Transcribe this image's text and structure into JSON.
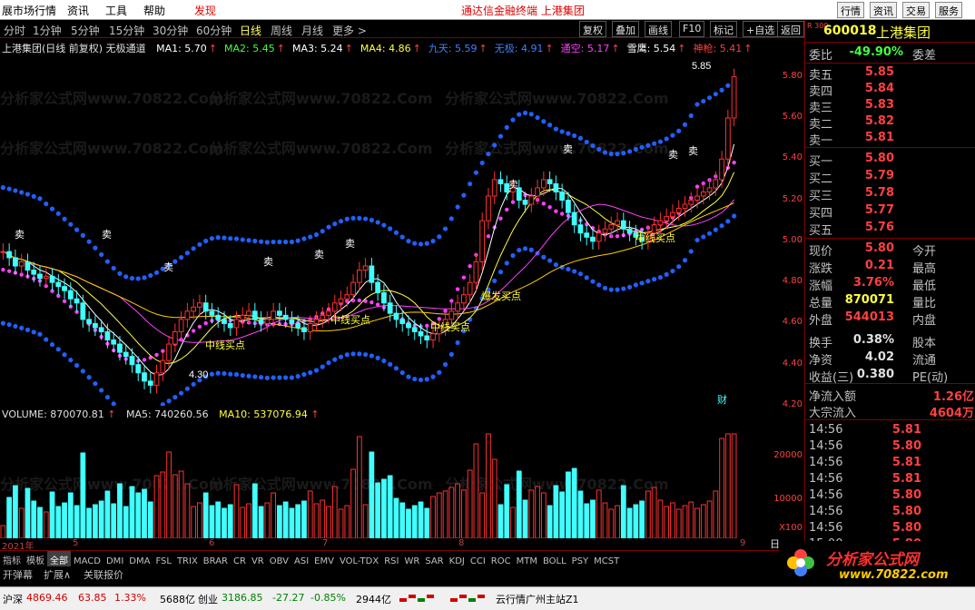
{
  "menubar": {
    "items": [
      "展市场行情",
      "资讯",
      "工具",
      "帮助",
      "发现"
    ],
    "center_title": "通达信金融终端  上港集团",
    "right_buttons": [
      "行情",
      "资讯",
      "交易",
      "服务"
    ]
  },
  "periods": {
    "items": [
      "分时",
      "1分钟",
      "5分钟",
      "15分钟",
      "30分钟",
      "60分钟",
      "日线",
      "周线",
      "月线",
      "更多 >"
    ],
    "active": "日线",
    "tools": [
      "复权",
      "叠加",
      "画线",
      "F10",
      "标记",
      "+自选",
      "返回"
    ]
  },
  "legend": {
    "title": "上港集团(日线 前复权) 无极通道",
    "items": [
      {
        "label": "MA1: 5.70",
        "color": "#ffffff"
      },
      {
        "label": "MA2: 5.45",
        "color": "#40ff40"
      },
      {
        "label": "MA3: 5.24",
        "color": "#ffffff"
      },
      {
        "label": "MA4: 4.86",
        "color": "#ffff40"
      },
      {
        "label": "九天: 5.59",
        "color": "#4080ff"
      },
      {
        "label": "无极: 4.91",
        "color": "#4080ff"
      },
      {
        "label": "通空: 5.17",
        "color": "#ff40ff"
      },
      {
        "label": "雪鹰: 5.54",
        "color": "#ffffff"
      },
      {
        "label": "神枪: 5.41",
        "color": "#ff4040"
      }
    ]
  },
  "chart_annotations": {
    "high": "5.85",
    "low": "4.30",
    "sell": "卖",
    "buy_mid": "中线买点",
    "burst": "爆发买点",
    "cai": "财"
  },
  "volume_legend": {
    "volume": "VOLUME: 870070.81",
    "ma5": "MA5: 740260.56",
    "ma10": "MA10: 537076.94"
  },
  "price_axis": [
    "5.80",
    "5.60",
    "5.40",
    "5.20",
    "5.00",
    "4.80",
    "4.60",
    "4.40",
    "4.20"
  ],
  "volume_axis": [
    "20000",
    "10000",
    "X100"
  ],
  "dates": {
    "start": "2021年",
    "m5": "5",
    "m6": "6",
    "m7": "7",
    "m8": "8",
    "m9": "9",
    "period": "日线"
  },
  "indicator_tabs": [
    "指标",
    "模板",
    "全部",
    "MACD",
    "DMI",
    "DMA",
    "FSL",
    "TRIX",
    "BRAR",
    "CR",
    "VR",
    "OBV",
    "ASI",
    "EMV",
    "VOL-TDX",
    "RSI",
    "WR",
    "SAR",
    "KDJ",
    "CCI",
    "ROC",
    "MTM",
    "BOLL",
    "PSY",
    "MCST"
  ],
  "bottom_tools": [
    "开弹幕",
    "扩展∧",
    "关联报价"
  ],
  "quote": {
    "code": "600018",
    "name": "上港集团",
    "badge": "R 300",
    "weibi_label": "委比",
    "weibi": "-49.90%",
    "weicha_label": "委差",
    "asks": [
      {
        "l": "卖五",
        "p": "5.85"
      },
      {
        "l": "卖四",
        "p": "5.84"
      },
      {
        "l": "卖三",
        "p": "5.83"
      },
      {
        "l": "卖二",
        "p": "5.82"
      },
      {
        "l": "卖一",
        "p": "5.81"
      }
    ],
    "bids": [
      {
        "l": "买一",
        "p": "5.80"
      },
      {
        "l": "买二",
        "p": "5.79"
      },
      {
        "l": "买三",
        "p": "5.78"
      },
      {
        "l": "买四",
        "p": "5.77"
      },
      {
        "l": "买五",
        "p": "5.76"
      }
    ],
    "stats": [
      {
        "l": "现价",
        "v": "5.80",
        "l2": "今开",
        "c": "red"
      },
      {
        "l": "涨跌",
        "v": "0.21",
        "l2": "最高",
        "c": "red"
      },
      {
        "l": "涨幅",
        "v": "3.76%",
        "l2": "最低",
        "c": "red"
      },
      {
        "l": "总量",
        "v": "870071",
        "l2": "量比",
        "c": "yel"
      },
      {
        "l": "外盘",
        "v": "544013",
        "l2": "内盘",
        "c": "red"
      },
      {
        "l": "换手",
        "v": "0.38%",
        "l2": "股本",
        "c": "wht"
      },
      {
        "l": "净资",
        "v": "4.02",
        "l2": "流通",
        "c": "wht"
      },
      {
        "l": "收益(三)",
        "v": "0.380",
        "l2": "PE(动)",
        "c": "wht"
      }
    ],
    "flow": [
      {
        "l": "净流入额",
        "v": "1.26亿"
      },
      {
        "l": "大宗流入",
        "v": "4604万"
      }
    ],
    "ticks": [
      {
        "t": "14:56",
        "p": "5.81"
      },
      {
        "t": "14:56",
        "p": "5.80"
      },
      {
        "t": "14:56",
        "p": "5.81"
      },
      {
        "t": "14:56",
        "p": "5.81"
      },
      {
        "t": "14:56",
        "p": "5.80"
      },
      {
        "t": "14:56",
        "p": "5.80"
      },
      {
        "t": "14:56",
        "p": "5.80"
      },
      {
        "t": "15:00",
        "p": "5.80"
      }
    ],
    "tick_extra": "7"
  },
  "status": {
    "sh_label": "沪深",
    "sh_val": "4869.46",
    "sh_chg": "63.85",
    "sh_pct": "1.33%",
    "sh_amt": "5688亿",
    "cy_label": "创业",
    "cy_val": "3186.85",
    "cy_chg": "-27.27",
    "cy_pct": "-0.85%",
    "cy_amt": "2944亿",
    "server": "云行情广州主站Z1",
    "logo": "分析家公式网",
    "logo_url": "www.70822.com"
  },
  "watermark": "分析家公式网www.70822.Com",
  "chart_data": {
    "type": "candlestick",
    "ylim": [
      4.2,
      5.9
    ],
    "close": [
      4.95,
      4.92,
      4.88,
      4.9,
      4.86,
      4.84,
      4.82,
      4.83,
      4.8,
      4.78,
      4.76,
      4.72,
      4.7,
      4.62,
      4.6,
      4.58,
      4.56,
      4.52,
      4.5,
      4.46,
      4.44,
      4.4,
      4.36,
      4.32,
      4.3,
      4.36,
      4.42,
      4.5,
      4.56,
      4.62,
      4.66,
      4.68,
      4.7,
      4.66,
      4.64,
      4.62,
      4.6,
      4.58,
      4.62,
      4.64,
      4.66,
      4.62,
      4.6,
      4.62,
      4.66,
      4.64,
      4.62,
      4.6,
      4.58,
      4.56,
      4.6,
      4.62,
      4.64,
      4.66,
      4.7,
      4.72,
      4.74,
      4.8,
      4.86,
      4.88,
      4.8,
      4.75,
      4.7,
      4.65,
      4.62,
      4.6,
      4.58,
      4.56,
      4.54,
      4.52,
      4.55,
      4.58,
      4.62,
      4.66,
      4.7,
      4.74,
      4.8,
      4.9,
      5.1,
      5.22,
      5.3,
      5.28,
      5.24,
      5.26,
      5.2,
      5.18,
      5.22,
      5.26,
      5.3,
      5.28,
      5.24,
      5.2,
      5.14,
      5.08,
      5.04,
      5.02,
      5.0,
      5.04,
      5.06,
      5.08,
      5.1,
      5.06,
      5.04,
      5.02,
      5.0,
      5.04,
      5.08,
      5.1,
      5.12,
      5.14,
      5.16,
      5.18,
      5.2,
      5.22,
      5.24,
      5.26,
      5.3,
      5.4,
      5.6,
      5.8
    ]
  }
}
